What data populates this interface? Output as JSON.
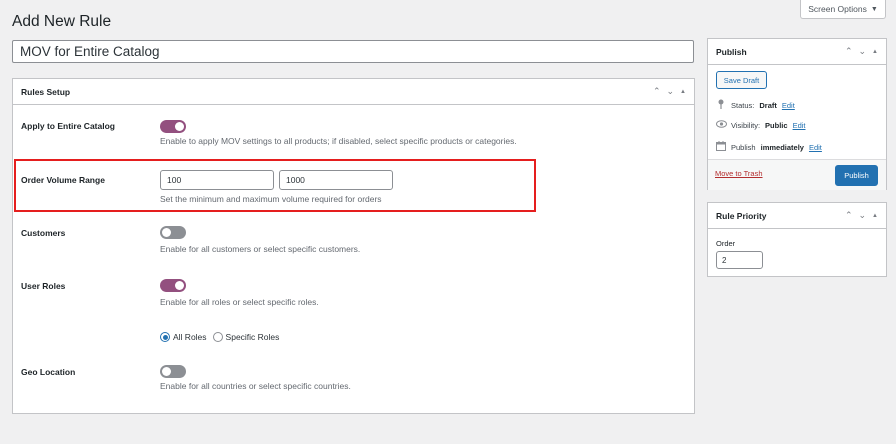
{
  "screen_options": {
    "label": "Screen Options",
    "caret": "▼"
  },
  "page": {
    "title": "Add New Rule"
  },
  "post_title": {
    "value": "MOV for Entire Catalog"
  },
  "rules_setup": {
    "heading": "Rules Setup",
    "rows": [
      {
        "label": "Apply to Entire Catalog",
        "toggle": "on",
        "description": "Enable to apply MOV settings to all products; if disabled, select specific products or categories."
      },
      {
        "label": "Order Volume Range",
        "min_value": "100",
        "max_value": "1000",
        "description": "Set the minimum and maximum volume required for orders"
      },
      {
        "label": "Customers",
        "toggle": "off",
        "description": "Enable for all customers or select specific customers."
      },
      {
        "label": "User Roles",
        "toggle": "on",
        "description": "Enable for all roles or select specific roles."
      },
      {
        "label": "Geo Location",
        "toggle": "off",
        "description": "Enable for all countries or select specific countries."
      }
    ],
    "roles_radio": {
      "options": [
        "All Roles",
        "Specific Roles"
      ],
      "selected": "All Roles"
    }
  },
  "publish": {
    "heading": "Publish",
    "save_draft": "Save Draft",
    "status_label": "Status:",
    "status_value": "Draft",
    "visibility_label": "Visibility:",
    "visibility_value": "Public",
    "publish_label": "Publish",
    "publish_value": "immediately",
    "edit": "Edit",
    "trash": "Move to Trash",
    "publish_button": "Publish"
  },
  "rule_priority": {
    "heading": "Rule Priority",
    "order_label": "Order",
    "order_value": "2"
  },
  "colors": {
    "accent": "#2271b1",
    "toggle_on": "#93507f",
    "toggle_off": "#8c8f94",
    "highlight": "#e51e1e"
  }
}
